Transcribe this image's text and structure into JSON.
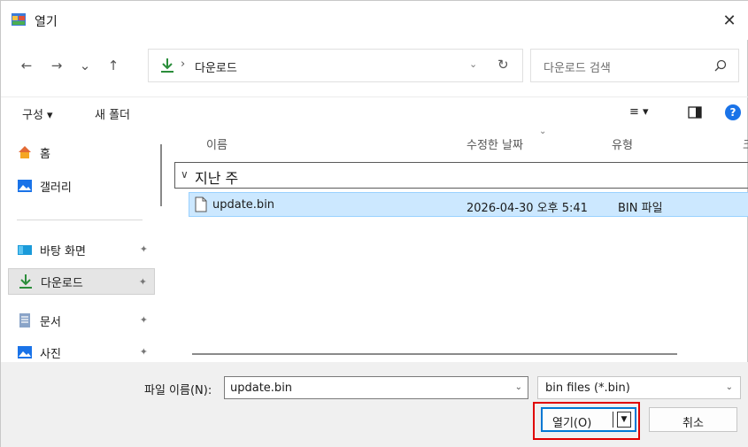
{
  "window": {
    "title": "열기",
    "close_glyph": "✕"
  },
  "nav": {
    "back_glyph": "←",
    "forward_glyph": "→",
    "recent_glyph": "⌄",
    "up_glyph": "↑",
    "address_separator": "›",
    "address_text": "다운로드",
    "address_dropdown_glyph": "⌄",
    "refresh_glyph": "↻",
    "search_placeholder": "다운로드 검색"
  },
  "toolbar": {
    "organize_label": "구성 ▾",
    "new_folder_label": "새 폴더",
    "view_glyph": "≡ ▾",
    "help_glyph": "?"
  },
  "sidebar": {
    "items": [
      {
        "label": "홈",
        "icon": "home-icon"
      },
      {
        "label": "갤러리",
        "icon": "gallery-icon"
      },
      {
        "label": "바탕 화면",
        "icon": "desktop-icon",
        "pinned": true
      },
      {
        "label": "다운로드",
        "icon": "download-icon",
        "pinned": true,
        "selected": true
      },
      {
        "label": "문서",
        "icon": "document-icon",
        "pinned": true
      },
      {
        "label": "사진",
        "icon": "pictures-icon",
        "pinned": true
      }
    ],
    "pin_glyph": "📌"
  },
  "filelist": {
    "columns": [
      "이름",
      "수정한 날짜",
      "유형",
      "크"
    ],
    "sort_glyph": "⌄",
    "group_chevron": "∨",
    "group_label": "지난 주",
    "files": [
      {
        "name": "update.bin",
        "modified": "2026-04-30 오후 5:41",
        "type": "BIN 파일"
      }
    ]
  },
  "bottom": {
    "filename_label": "파일 이름(N):",
    "filename_value": "update.bin",
    "filename_dropdown_glyph": "⌄",
    "filter_value": "bin files (*.bin)",
    "filter_dropdown_glyph": "⌄",
    "open_label": "열기(O)",
    "open_dropdown_glyph": "▼",
    "cancel_label": "취소"
  },
  "colors": {
    "accent": "#0078d4",
    "selection_bg": "#cce8ff",
    "highlight_border": "#e00000"
  }
}
